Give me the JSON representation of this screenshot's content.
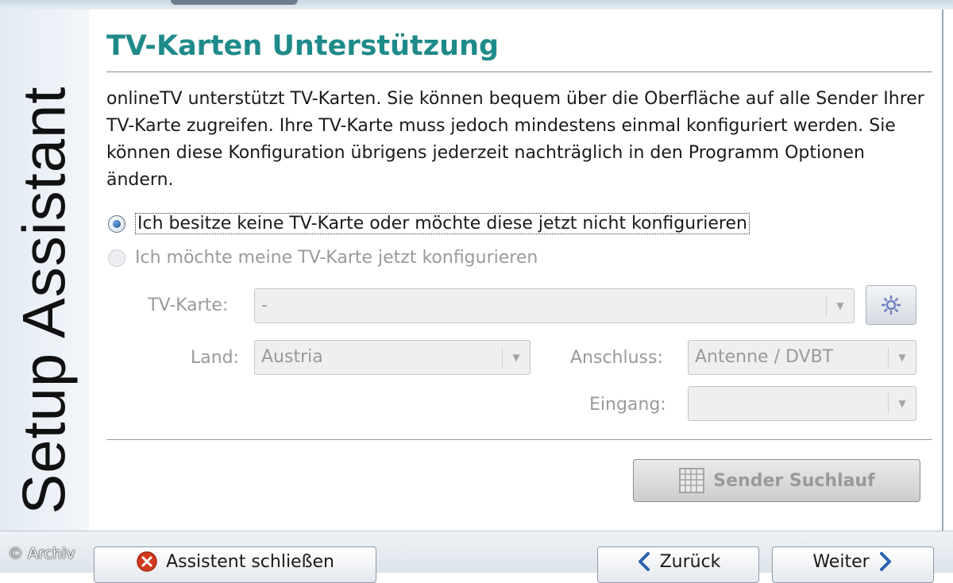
{
  "sidebar": {
    "title": "Setup Assistant"
  },
  "page": {
    "title": "TV-Karten Unterstützung",
    "description": "onlineTV unterstützt TV-Karten. Sie können bequem über die Oberfläche auf alle Sender Ihrer TV-Karte zugreifen. Ihre TV-Karte muss jedoch mindestens einmal konfiguriert werden. Sie können diese Konfiguration übrigens jederzeit nachträglich in den Programm Optionen ändern."
  },
  "options": [
    {
      "label": "Ich besitze keine TV-Karte oder möchte diese jetzt nicht konfigurieren",
      "selected": true,
      "enabled": true
    },
    {
      "label": "Ich möchte meine TV-Karte jetzt konfigurieren",
      "selected": false,
      "enabled": false
    }
  ],
  "form": {
    "tv_card": {
      "label": "TV-Karte:",
      "value": "-"
    },
    "country": {
      "label": "Land:",
      "value": "Austria"
    },
    "connection": {
      "label": "Anschluss:",
      "value": "Antenne / DVBT"
    },
    "input": {
      "label": "Eingang:",
      "value": ""
    }
  },
  "buttons": {
    "scan": "Sender Suchlauf",
    "close": "Assistent schließen",
    "back": "Zurück",
    "next": "Weiter"
  },
  "watermark": "© Archiv",
  "icons": {
    "config": "gear-icon",
    "scan": "grid-icon",
    "close": "close-circle-icon",
    "back": "chevron-left-icon",
    "next": "chevron-right-icon"
  },
  "colors": {
    "title": "#1f8a8a",
    "accent": "#1c4f92",
    "close_icon": "#d23a1e"
  }
}
